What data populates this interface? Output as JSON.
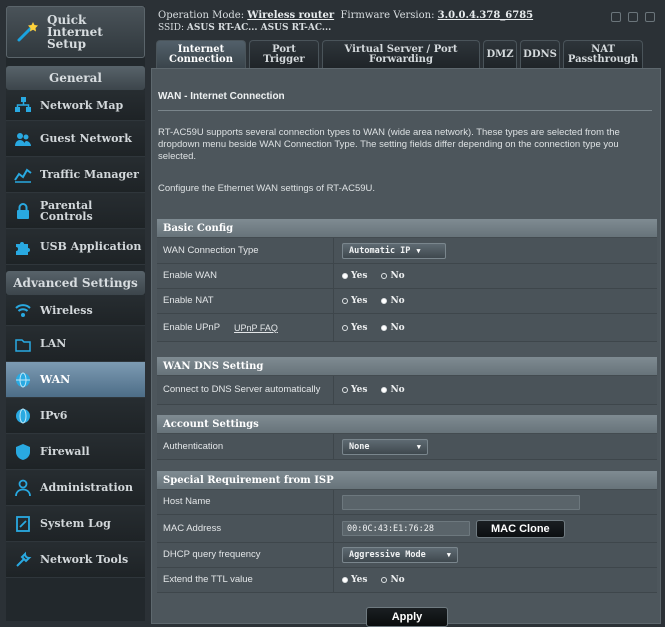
{
  "sidebar": {
    "quick_setup": "Quick Internet Setup",
    "general_header": "General",
    "general_items": [
      {
        "label": "Network Map",
        "icon": "network-map-icon"
      },
      {
        "label": "Guest Network",
        "icon": "guest-network-icon"
      },
      {
        "label": "Traffic Manager",
        "icon": "traffic-manager-icon"
      },
      {
        "label": "Parental Controls",
        "icon": "parental-controls-icon"
      },
      {
        "label": "USB Application",
        "icon": "usb-icon"
      }
    ],
    "advanced_header": "Advanced Settings",
    "advanced_items": [
      {
        "label": "Wireless",
        "icon": "wireless-icon"
      },
      {
        "label": "LAN",
        "icon": "lan-icon"
      },
      {
        "label": "WAN",
        "icon": "wan-icon",
        "active": true
      },
      {
        "label": "IPv6",
        "icon": "ipv6-icon"
      },
      {
        "label": "Firewall",
        "icon": "firewall-icon"
      },
      {
        "label": "Administration",
        "icon": "administration-icon"
      },
      {
        "label": "System Log",
        "icon": "system-log-icon"
      },
      {
        "label": "Network Tools",
        "icon": "network-tools-icon"
      }
    ]
  },
  "topbar": {
    "op_mode_label": "Operation Mode:",
    "op_mode_value": "Wireless router",
    "fw_label": "Firmware Version:",
    "fw_value": "3.0.0.4.378_6785",
    "ssid_label": "SSID:",
    "ssid_value": "ASUS  RT-AC...  ASUS  RT-AC..."
  },
  "tabs": [
    {
      "label": "Internet Connection",
      "active": true
    },
    {
      "label": "Port Trigger"
    },
    {
      "label": "Virtual Server / Port Forwarding"
    },
    {
      "label": "DMZ"
    },
    {
      "label": "DDNS"
    },
    {
      "label": "NAT Passthrough"
    }
  ],
  "main": {
    "title": "WAN - Internet Connection",
    "description": "RT-AC59U supports several connection types to WAN (wide area network). These types are selected from the dropdown menu beside WAN Connection Type. The setting fields differ depending on the connection type you selected.",
    "configure": "Configure the Ethernet WAN settings of RT-AC59U.",
    "basic_config": {
      "header": "Basic Config",
      "wan_type_label": "WAN Connection Type",
      "wan_type_value": "Automatic IP",
      "enable_wan_label": "Enable WAN",
      "enable_nat_label": "Enable NAT",
      "enable_upnp_label": "Enable UPnP",
      "upnp_faq": "UPnP FAQ",
      "yes": "Yes",
      "no": "No"
    },
    "dns": {
      "header": "WAN DNS Setting",
      "connect_label": "Connect to DNS Server automatically"
    },
    "account": {
      "header": "Account Settings",
      "auth_label": "Authentication",
      "auth_value": "None"
    },
    "special": {
      "header": "Special Requirement from ISP",
      "host_label": "Host Name",
      "host_value": "",
      "mac_label": "MAC Address",
      "mac_value": "00:0C:43:E1:76:28",
      "mac_clone": "MAC Clone",
      "dhcp_label": "DHCP query frequency",
      "dhcp_value": "Aggressive Mode",
      "ttl_label": "Extend the TTL value"
    },
    "apply": "Apply"
  }
}
